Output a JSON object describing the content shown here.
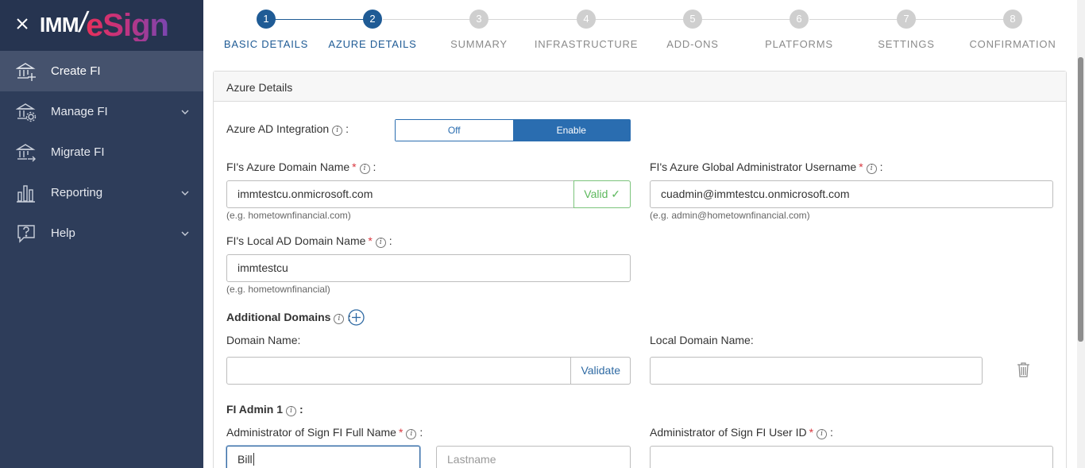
{
  "sidebar": {
    "logo_primary": "IMM",
    "logo_slash": "/",
    "logo_secondary": "eSign",
    "items": [
      {
        "label": "Create FI",
        "icon": "bank-plus-icon",
        "active": true
      },
      {
        "label": "Manage FI",
        "icon": "bank-gear-icon",
        "expandable": true
      },
      {
        "label": "Migrate FI",
        "icon": "bank-arrow-icon"
      },
      {
        "label": "Reporting",
        "icon": "bar-chart-icon",
        "expandable": true
      },
      {
        "label": "Help",
        "icon": "help-bubble-icon",
        "expandable": true
      }
    ]
  },
  "stepper": {
    "steps": [
      {
        "num": "1",
        "label": "BASIC DETAILS",
        "done": true
      },
      {
        "num": "2",
        "label": "AZURE DETAILS",
        "done": true
      },
      {
        "num": "3",
        "label": "SUMMARY",
        "done": false
      },
      {
        "num": "4",
        "label": "INFRASTRUCTURE",
        "done": false
      },
      {
        "num": "5",
        "label": "ADD-ONS",
        "done": false
      },
      {
        "num": "6",
        "label": "PLATFORMS",
        "done": false
      },
      {
        "num": "7",
        "label": "SETTINGS",
        "done": false
      },
      {
        "num": "8",
        "label": "CONFIRMATION",
        "done": false
      }
    ]
  },
  "form": {
    "title": "Azure Details",
    "azure_ad": {
      "label": "Azure AD Integration",
      "suffix": ":",
      "off_label": "Off",
      "on_label": "Enable",
      "value": "Enable"
    },
    "domain_name": {
      "label": "FI's Azure Domain Name",
      "suffix": ":",
      "value": "immtestcu.onmicrosoft.com",
      "status": "Valid ✓",
      "hint": "(e.g. hometownfinancial.com)"
    },
    "global_admin": {
      "label": "FI's Azure Global Administrator Username",
      "suffix": ":",
      "value": "cuadmin@immtestcu.onmicrosoft.com",
      "hint": "(e.g. admin@hometownfinancial.com)"
    },
    "local_domain": {
      "label": "FI's Local AD Domain Name",
      "suffix": ":",
      "value": "immtestcu",
      "hint": "(e.g. hometownfinancial)"
    },
    "additional_domains": {
      "label": "Additional Domains",
      "suffix": ":"
    },
    "domain_row": {
      "domain_label": "Domain Name:",
      "validate_label": "Validate",
      "local_label": "Local Domain Name:",
      "domain_value": "",
      "local_value": ""
    },
    "fi_admin": {
      "label": "FI Admin 1",
      "suffix": ":"
    },
    "admin_fullname": {
      "label": "Administrator of Sign FI Full Name",
      "suffix": ":",
      "first_value": "Bill",
      "last_placeholder": "Lastname"
    },
    "admin_userid": {
      "label": "Administrator of Sign FI User ID",
      "suffix": ":",
      "value": ""
    }
  },
  "colors": {
    "sidebar": "#2e3d5a",
    "accent": "#1f5b95",
    "valid": "#5cb85c",
    "required": "#d9363e"
  }
}
